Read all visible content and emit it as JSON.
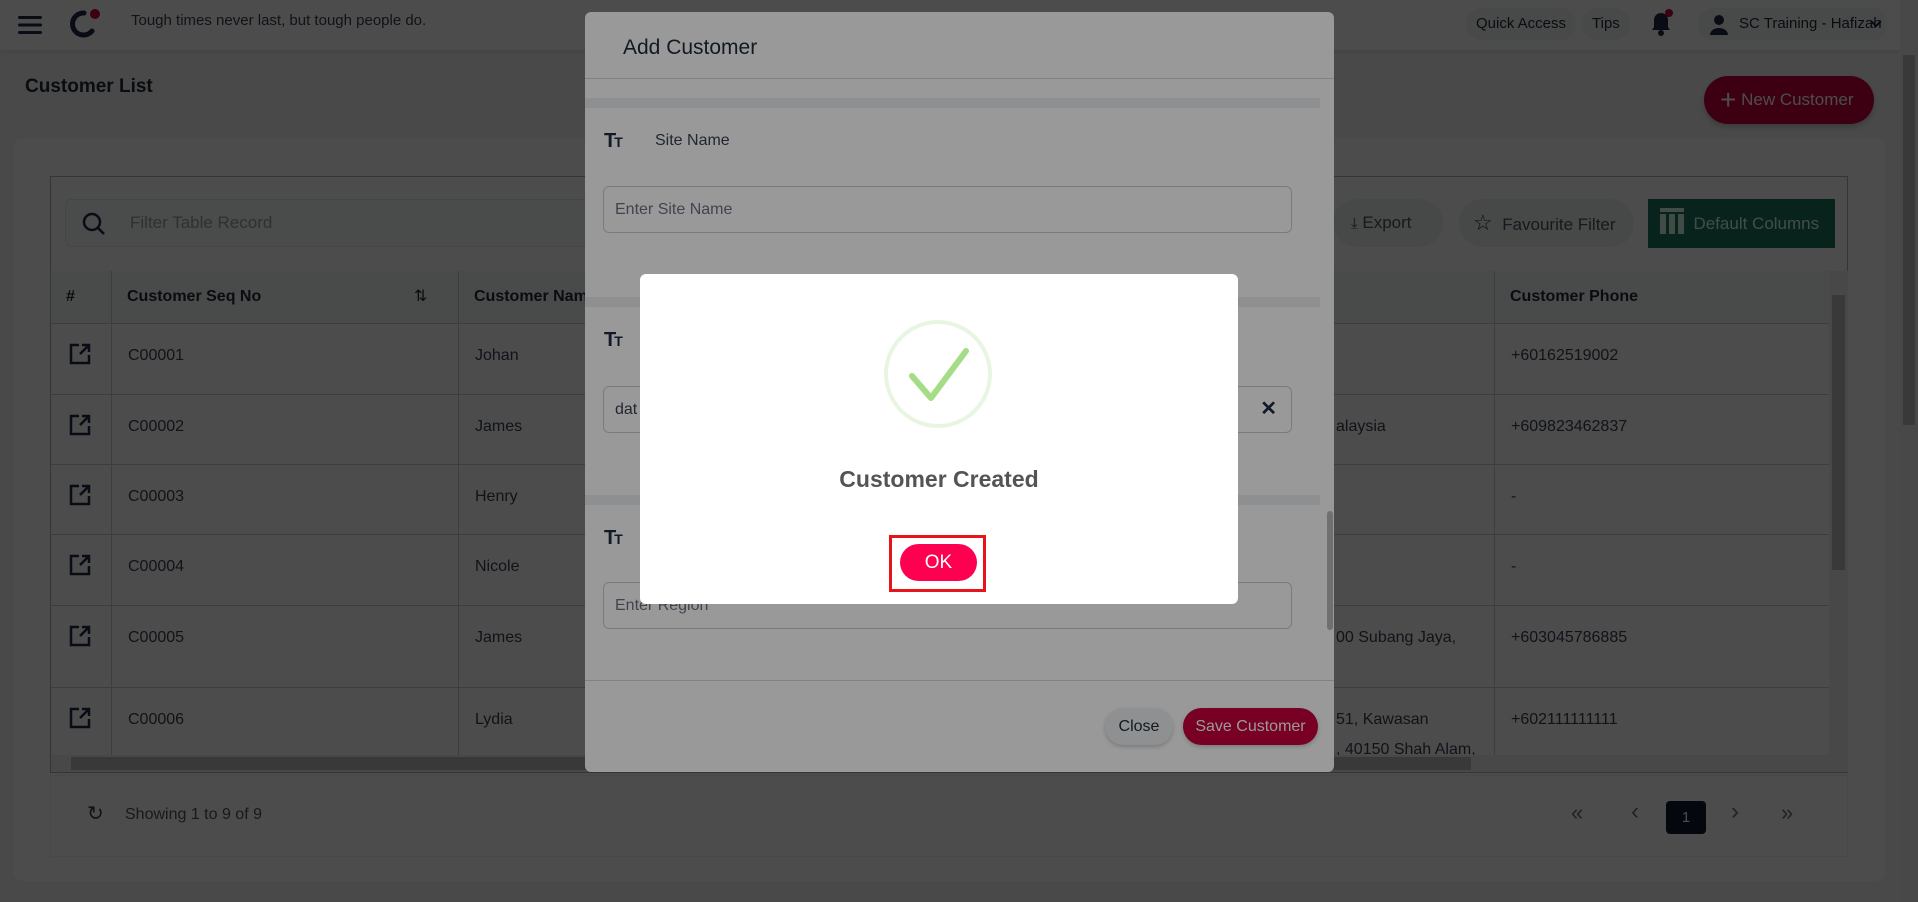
{
  "header": {
    "tagline": "Tough times never last, but tough people do.",
    "quick_access": "Quick Access",
    "tips": "Tips",
    "user": "SC Training - Hafizah"
  },
  "page": {
    "title": "Customer List",
    "new_button": "New Customer"
  },
  "toolbar": {
    "filter_placeholder": "Filter Table Record",
    "export": "Export",
    "favourite": "Favourite Filter",
    "default_columns": "Default Columns"
  },
  "table": {
    "columns": {
      "index": "#",
      "seq": "Customer Seq No",
      "name": "Customer Name",
      "phone": "Customer Phone"
    },
    "rows": [
      {
        "seq": "C00001",
        "name": "Johan",
        "address": "",
        "phone": "+60162519002"
      },
      {
        "seq": "C00002",
        "name": "James",
        "address": "alaysia",
        "phone": "+609823462837"
      },
      {
        "seq": "C00003",
        "name": "Henry",
        "address": "",
        "phone": "-"
      },
      {
        "seq": "C00004",
        "name": "Nicole",
        "address": "",
        "phone": "-"
      },
      {
        "seq": "C00005",
        "name": "James",
        "address": "00 Subang Jaya,",
        "phone": "+603045786885"
      },
      {
        "seq": "C00006",
        "name": "Lydia",
        "address": "51, Kawasan",
        "address2": ", 40150 Shah Alam,",
        "phone": "+602111111111"
      }
    ]
  },
  "footer": {
    "showing": "Showing 1 to 9 of 9",
    "current_page": "1",
    "first": "«",
    "prev": "‹",
    "next": "›",
    "last": "»"
  },
  "modal": {
    "title": "Add Customer",
    "site_name_label": "Site Name",
    "site_name_placeholder": "Enter Site Name",
    "field2_value": "dat",
    "region_placeholder": "Enter Region",
    "close": "Close",
    "save": "Save Customer"
  },
  "alert": {
    "message": "Customer Created",
    "ok": "OK"
  },
  "colors": {
    "brand": "#c8003f",
    "ok_button": "#ff0050",
    "teal": "#1c7560",
    "success": "#a5dc86",
    "highlight": "#e8141c"
  }
}
